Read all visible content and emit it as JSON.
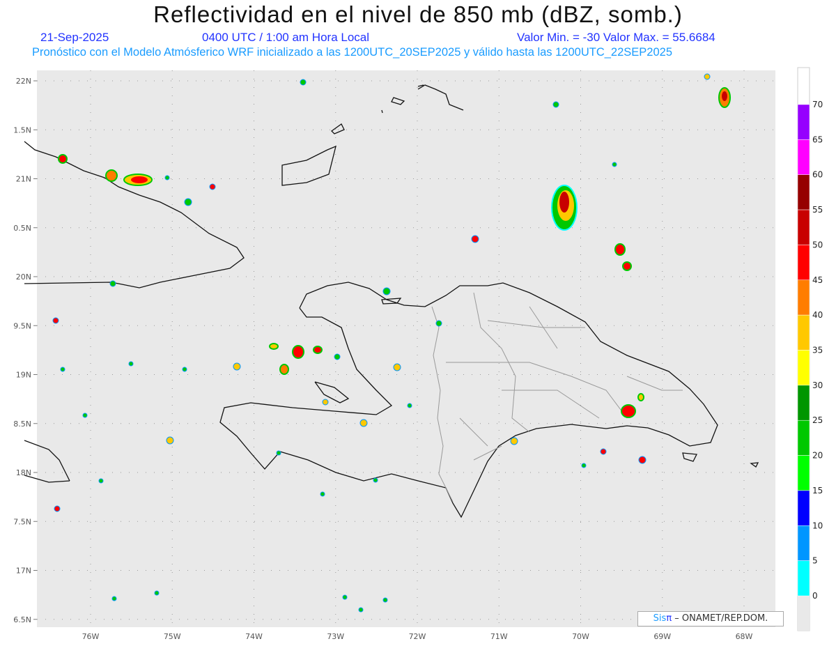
{
  "header": {
    "title": "Reflectividad en el nivel de 850 mb (dBZ, somb.)",
    "date": "21-Sep-2025",
    "time": "0400 UTC / 1:00 am Hora Local",
    "min_max": "Valor Min. = -30  Valor Max. = 55.6684",
    "subtitle": "Pronóstico con el Modelo Atmósferico WRF inicializado a las 1200UTC_20SEP2025 y válido hasta las  1200UTC_22SEP2025"
  },
  "axes": {
    "lat_labels": [
      "22N",
      "1.5N",
      "21N",
      "0.5N",
      "20N",
      "9.5N",
      "19N",
      "8.5N",
      "18N",
      "7.5N",
      "17N",
      "6.5N"
    ],
    "lon_labels": [
      "76W",
      "75W",
      "74W",
      "73W",
      "72W",
      "71W",
      "70W",
      "69W",
      "68W"
    ]
  },
  "colorbar": {
    "labels": [
      "70",
      "65",
      "60",
      "55",
      "50",
      "45",
      "40",
      "35",
      "30",
      "25",
      "20",
      "15",
      "10",
      "5",
      "0"
    ],
    "colors": [
      "#9600fe",
      "#ff00ff",
      "#960000",
      "#c80000",
      "#ff0000",
      "#ff7d00",
      "#ffc800",
      "#ffff00",
      "#009600",
      "#00c800",
      "#00ff00",
      "#0000ff",
      "#0096ff",
      "#00ffff"
    ]
  },
  "credit": {
    "brand_a": "Sis",
    "brand_b": "π",
    "text": "– ONAMET/REP.DOM."
  }
}
